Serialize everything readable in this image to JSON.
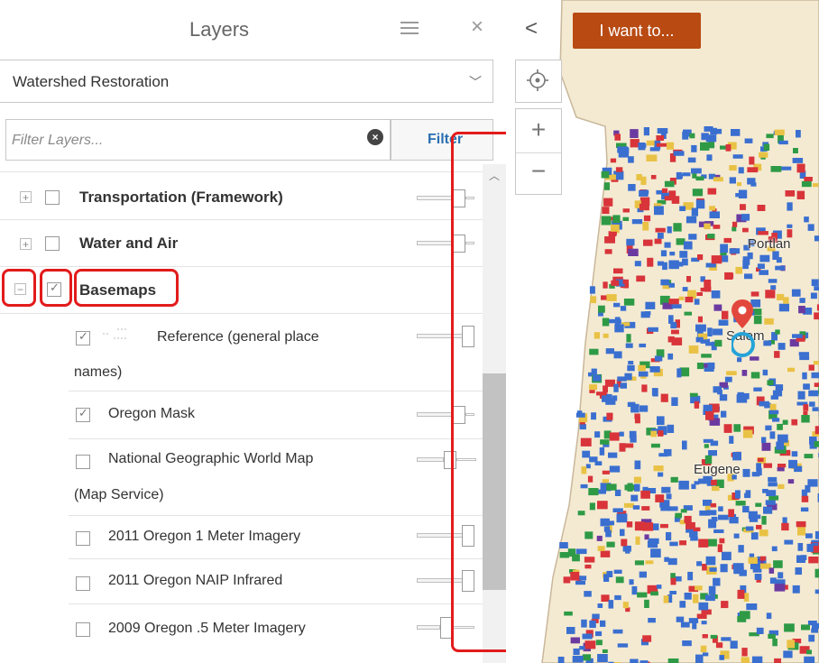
{
  "panel": {
    "title": "Layers",
    "close_symbol": "×",
    "theme_select": {
      "value": "Watershed Restoration",
      "chevron": "﹀"
    },
    "filter": {
      "placeholder": "Filter Layers...",
      "clear_symbol": "×",
      "button_label": "Filter"
    },
    "groups": [
      {
        "label": "Transportation (Framework)",
        "expander": "+",
        "checked": false
      },
      {
        "label": "Water and Air",
        "expander": "+",
        "checked": false
      },
      {
        "label": "Basemaps",
        "expander": "−",
        "checked": true
      }
    ],
    "basemap_layers": [
      {
        "label_line1": "Reference (general place",
        "label_line2": "names)",
        "checked": true
      },
      {
        "label_line1": "Oregon Mask",
        "label_line2": "",
        "checked": true
      },
      {
        "label_line1": "National Geographic World Map",
        "label_line2": "(Map Service)",
        "checked": false
      },
      {
        "label_line1": "2011 Oregon 1 Meter Imagery",
        "label_line2": "",
        "checked": false
      },
      {
        "label_line1": "2011 Oregon NAIP Infrared",
        "label_line2": "",
        "checked": false
      },
      {
        "label_line1": "2009 Oregon .5 Meter Imagery",
        "label_line2": "",
        "checked": false
      }
    ],
    "check_symbol": "✓"
  },
  "map": {
    "collapse_symbol": "<",
    "want_button_label": "I want to...",
    "zoom_in_symbol": "+",
    "zoom_out_symbol": "−",
    "place_labels": [
      "Portlan",
      "Salem",
      "Eugene"
    ],
    "colors": {
      "land": "#f4ead2",
      "pin": "#e2473d",
      "want_button": "#b84a12",
      "highlight": "#e21b1b",
      "markers": [
        "#3a6fd0",
        "#d8343a",
        "#2e9a46",
        "#e9c245",
        "#6b3aa0"
      ]
    }
  }
}
